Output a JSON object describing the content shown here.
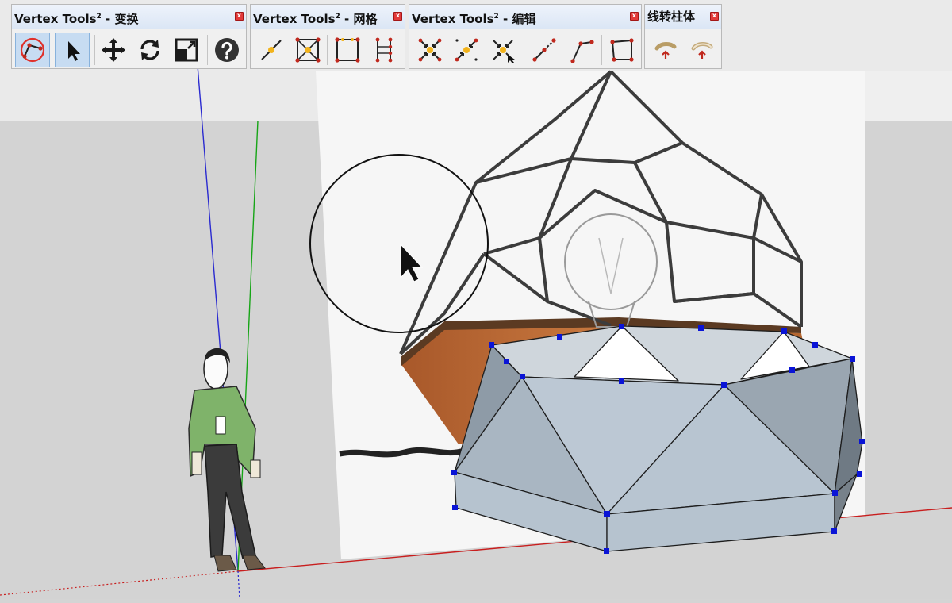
{
  "toolbars": [
    {
      "title_main": "Vertex Tools",
      "title_sup": "2",
      "title_suffix": " - 变换",
      "close_label": "x",
      "buttons": [
        {
          "name": "soft-select-icon",
          "active": true
        },
        {
          "name": "select-arrow-icon",
          "active": true
        },
        {
          "name": "move-icon"
        },
        {
          "name": "rotate-icon"
        },
        {
          "name": "scale-icon"
        },
        {
          "name": "help-icon"
        }
      ]
    },
    {
      "title_main": "Vertex Tools",
      "title_sup": "2",
      "title_suffix": " - 网格",
      "close_label": "x",
      "buttons": [
        {
          "name": "divide-edge-icon"
        },
        {
          "name": "divide-face-icon"
        },
        {
          "name": "subdivide-quad-icon"
        },
        {
          "name": "edge-columns-icon"
        }
      ]
    },
    {
      "title_main": "Vertex Tools",
      "title_sup": "2",
      "title_suffix": " - 编辑",
      "close_label": "x",
      "buttons": [
        {
          "name": "merge-vertices-icon"
        },
        {
          "name": "merge-to-center-icon"
        },
        {
          "name": "merge-to-point-icon"
        },
        {
          "name": "connect-vertices-icon"
        },
        {
          "name": "split-edge-icon"
        },
        {
          "name": "make-face-icon"
        }
      ]
    },
    {
      "title_main": "线转柱体",
      "title_sup": "",
      "title_suffix": "",
      "close_label": "x",
      "buttons": [
        {
          "name": "line-to-cylinder-icon"
        },
        {
          "name": "line-to-tube-icon"
        }
      ]
    }
  ],
  "viewport": {
    "sky_color": "#eeeeee",
    "ground_color": "#d6d6d6",
    "model_face_color": "#b9c6d3",
    "model_dark_face_color": "#7c8a96",
    "vertex_color": "#0010d0",
    "axis_red": "#c81e1e",
    "axis_green": "#16a516",
    "axis_blue": "#1f1fc0"
  }
}
